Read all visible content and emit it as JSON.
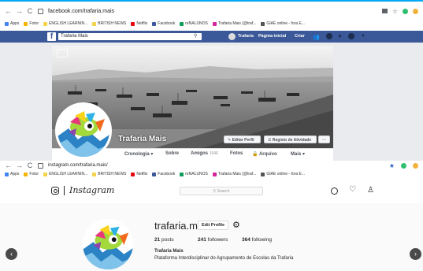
{
  "top_browser": {
    "url": "facebook.com/trafaria.mais",
    "bookmarks": [
      "Apps",
      "Fotor",
      "ENGLISH LEARNIN...",
      "BRITISH NEWS",
      "Netflix",
      "Facebook",
      "reNALUNOS",
      "Trafaria Mais (@traf...",
      "GIAE online - fora E..."
    ]
  },
  "facebook": {
    "search_value": "Trafaria Mais",
    "nav": {
      "page_name": "Trafaria",
      "home": "Página inicial",
      "create": "Criar"
    },
    "page_name": "Trafaria Mais",
    "buttons": {
      "edit_profile": "Editar Perfil",
      "activity_log": "Registo de Atividade",
      "more": "···"
    },
    "tabs": [
      "Cronologia ▾",
      "Sobre",
      "Amigos",
      "Fotos",
      "Arquivo",
      "Mais ▾"
    ],
    "friends_count": "1646"
  },
  "bottom_browser": {
    "url": "instagram.com/trafaria.mais/",
    "bookmarks": [
      "Apps",
      "Fotor",
      "ENGLISH LEARNIN...",
      "BRITISH NEWS",
      "Netflix",
      "Facebook",
      "reNALUNOS",
      "Trafaria Mais (@traf...",
      "GIAE online - fora E..."
    ]
  },
  "instagram": {
    "brand": "Instagram",
    "search_placeholder": "Search",
    "username": "trafaria.mais",
    "edit_profile": "Edit Profile",
    "posts_count": "21",
    "posts_label": "posts",
    "followers_count": "241",
    "followers_label": "followers",
    "following_count": "364",
    "following_label": "following",
    "full_name": "Trafaria Mais",
    "bio": "Plataforma Interdisciplinar do Agrupamento de Escolas da Trafaria"
  },
  "colors": {
    "facebook_blue": "#3b5998",
    "chrome_accent": "#03a9f4"
  }
}
